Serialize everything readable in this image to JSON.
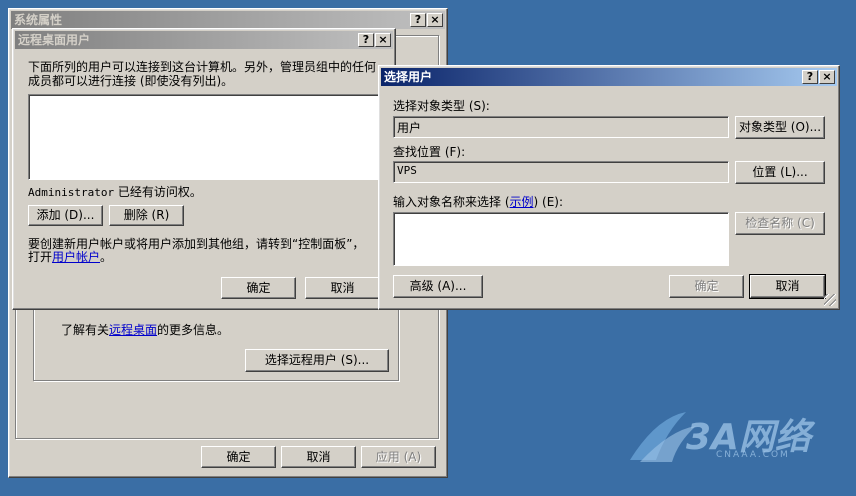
{
  "sysprops": {
    "title": "系统属性",
    "help": "?",
    "close": "×",
    "info_prefix": "了解有关",
    "info_link": "远程桌面",
    "info_suffix": "的更多信息。",
    "select_remote_users": "选择远程用户 (S)...",
    "ok": "确定",
    "cancel": "取消",
    "apply": "应用 (A)"
  },
  "rdusers": {
    "title": "远程桌面用户",
    "help": "?",
    "close": "×",
    "desc": "下面所列的用户可以连接到这台计算机。另外，管理员组中的任何成员都可以进行连接 (即使没有列出)。",
    "admin_user": "Administrator",
    "admin_status": " 已经有访问权。",
    "add": "添加 (D)...",
    "remove": "删除 (R)",
    "note_line1": "要创建新用户帐户或将用户添加到其他组，请转到“控制面板”，",
    "note_prefix": "打开",
    "note_link": "用户帐户",
    "note_suffix": "。",
    "ok": "确定",
    "cancel": "取消"
  },
  "selectusers": {
    "title": "选择用户",
    "help": "?",
    "close": "×",
    "object_type_label": "选择对象类型 (S):",
    "object_type_value": "用户",
    "object_type_button": "对象类型 (O)...",
    "location_label": "查找位置 (F):",
    "location_value": "VPS",
    "location_button": "位置 (L)...",
    "names_label_prefix": "输入对象名称来选择 (",
    "names_label_link": "示例",
    "names_label_suffix": ") (E):",
    "names_value": "",
    "check_names": "检查名称 (C)",
    "advanced": "高级 (A)...",
    "ok": "确定",
    "cancel": "取消"
  },
  "watermark": {
    "brand": "3A网络",
    "site": "CNAAA.COM"
  }
}
